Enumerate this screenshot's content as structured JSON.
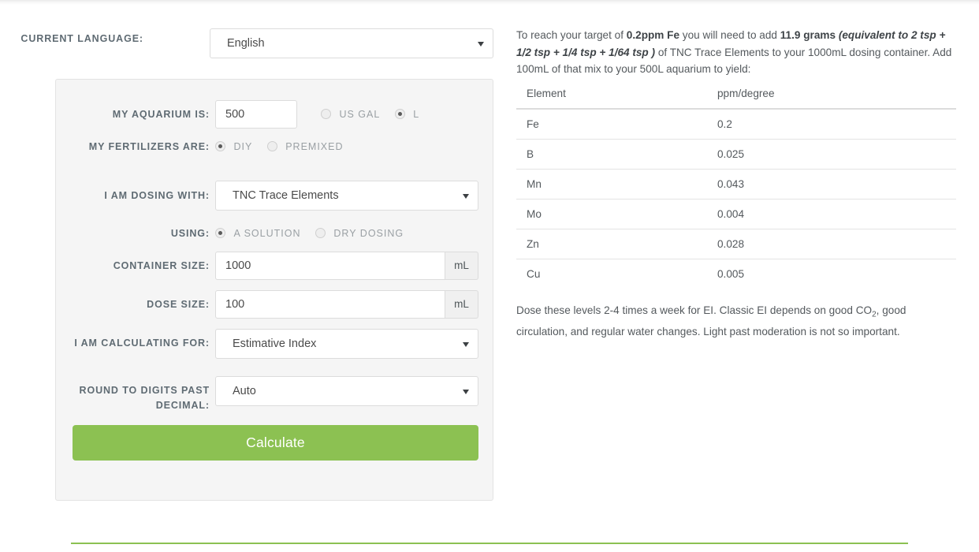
{
  "language_row": {
    "label": "CURRENT LANGUAGE:",
    "value": "English"
  },
  "form": {
    "aquarium": {
      "label": "MY AQUARIUM IS:",
      "value": "500",
      "units": [
        {
          "label": "US GAL",
          "selected": false
        },
        {
          "label": "L",
          "selected": true
        }
      ]
    },
    "fertilizers": {
      "label": "MY FERTILIZERS ARE:",
      "options": [
        {
          "label": "DIY",
          "selected": true
        },
        {
          "label": "PREMIXED",
          "selected": false
        }
      ]
    },
    "dosing_with": {
      "label": "I AM DOSING WITH:",
      "value": "TNC Trace Elements"
    },
    "using": {
      "label": "USING:",
      "options": [
        {
          "label": "A SOLUTION",
          "selected": true
        },
        {
          "label": "DRY DOSING",
          "selected": false
        }
      ]
    },
    "container_size": {
      "label": "CONTAINER SIZE:",
      "value": "1000",
      "unit": "mL"
    },
    "dose_size": {
      "label": "DOSE SIZE:",
      "value": "100",
      "unit": "mL"
    },
    "calculating_for": {
      "label": "I AM CALCULATING FOR:",
      "value": "Estimative Index"
    },
    "rounding": {
      "label": "ROUND TO DIGITS PAST DECIMAL:",
      "value": "Auto"
    },
    "calculate_button": "Calculate"
  },
  "results": {
    "summary": {
      "part1": "To reach your target of ",
      "bold1": "0.2ppm Fe",
      "part2": " you will need to add ",
      "bold2": "11.9 grams ",
      "bolditalic": "(equivalent to 2 tsp + 1/2 tsp + 1/4 tsp + 1/64 tsp )",
      "part3": " of TNC Trace Elements to your 1000mL dosing container. Add 100mL of that mix to your 500L aquarium to yield:"
    },
    "table": {
      "headers": [
        "Element",
        "ppm/degree"
      ],
      "rows": [
        [
          "Fe",
          "0.2"
        ],
        [
          "B",
          "0.025"
        ],
        [
          "Mn",
          "0.043"
        ],
        [
          "Mo",
          "0.004"
        ],
        [
          "Zn",
          "0.028"
        ],
        [
          "Cu",
          "0.005"
        ]
      ]
    },
    "note": {
      "part1": "Dose these levels 2-4 times a week for EI. Classic EI depends on good CO",
      "sub": "2",
      "part2": ", good circulation, and regular water changes. Light past moderation is not so important."
    }
  },
  "theme": {
    "accent_green": "#8cc152",
    "panel_bg": "#f5f5f5",
    "label_color": "#5f6b73",
    "text_color": "#54595d"
  }
}
